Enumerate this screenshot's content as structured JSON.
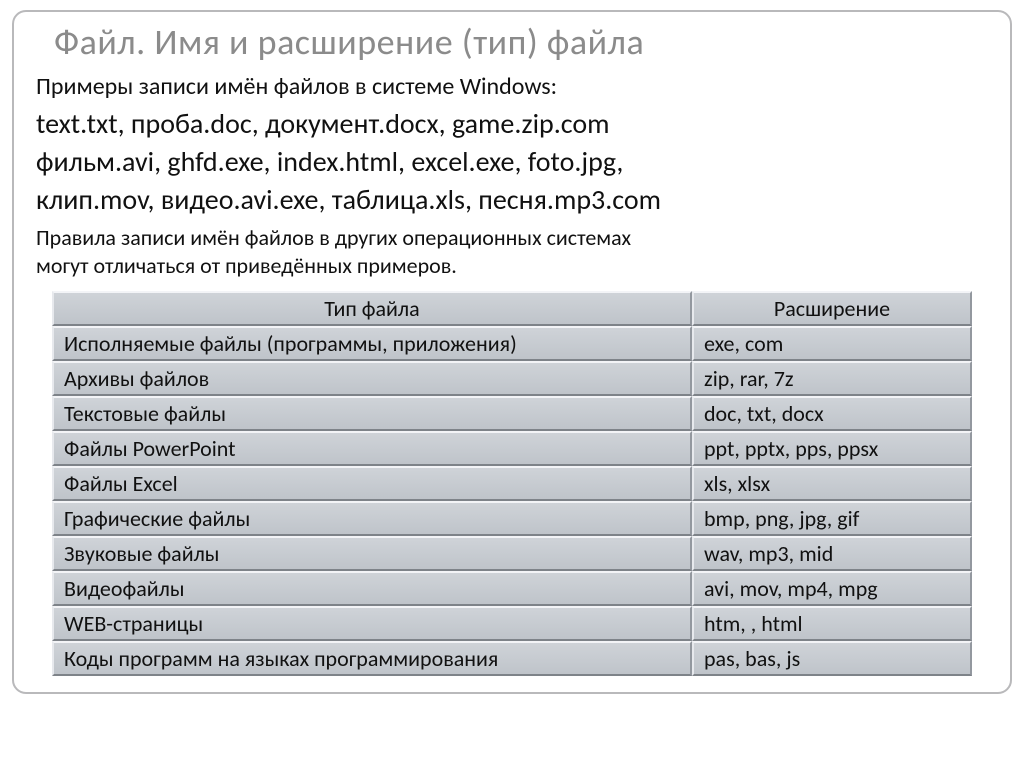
{
  "title": "Файл. Имя и расширение (тип) файла",
  "intro": "Примеры записи имён файлов в системе Windows:",
  "examples_line1": "text.txt, проба.doc, документ.docx, game.zip.com",
  "examples_line2": "фильм.avi, ghfd.exe, index.html, excel.exe, foto.jpg,",
  "examples_line3": "клип.mov, видео.avi.exe, таблица.xls, песня.mp3.com",
  "note_line1": "Правила записи имён файлов в других операционных системах",
  "note_line2": "могут отличаться от приведённых примеров.",
  "table": {
    "header_type": "Тип файла",
    "header_ext": "Расширение",
    "rows": [
      {
        "type": "Исполняемые файлы (программы, приложения)",
        "ext": "exe, com"
      },
      {
        "type": "Архивы файлов",
        "ext": "zip, rar, 7z"
      },
      {
        "type": "Текстовые файлы",
        "ext": "doc, txt, docx"
      },
      {
        "type": "Файлы PowerPoint",
        "ext": "ppt, pptx, pps, ppsx"
      },
      {
        "type": "Файлы Excel",
        "ext": "xls, xlsx"
      },
      {
        "type": "Графические файлы",
        "ext": "bmp, png, jpg, gif"
      },
      {
        "type": "Звуковые файлы",
        "ext": "wav, mp3, mid"
      },
      {
        "type": "Видеофайлы",
        "ext": "avi, mov, mp4, mpg"
      },
      {
        "type": "WEB-страницы",
        "ext": "htm, , html"
      },
      {
        "type": "Коды программ на языках программирования",
        "ext": "pas, bas, js"
      }
    ]
  }
}
